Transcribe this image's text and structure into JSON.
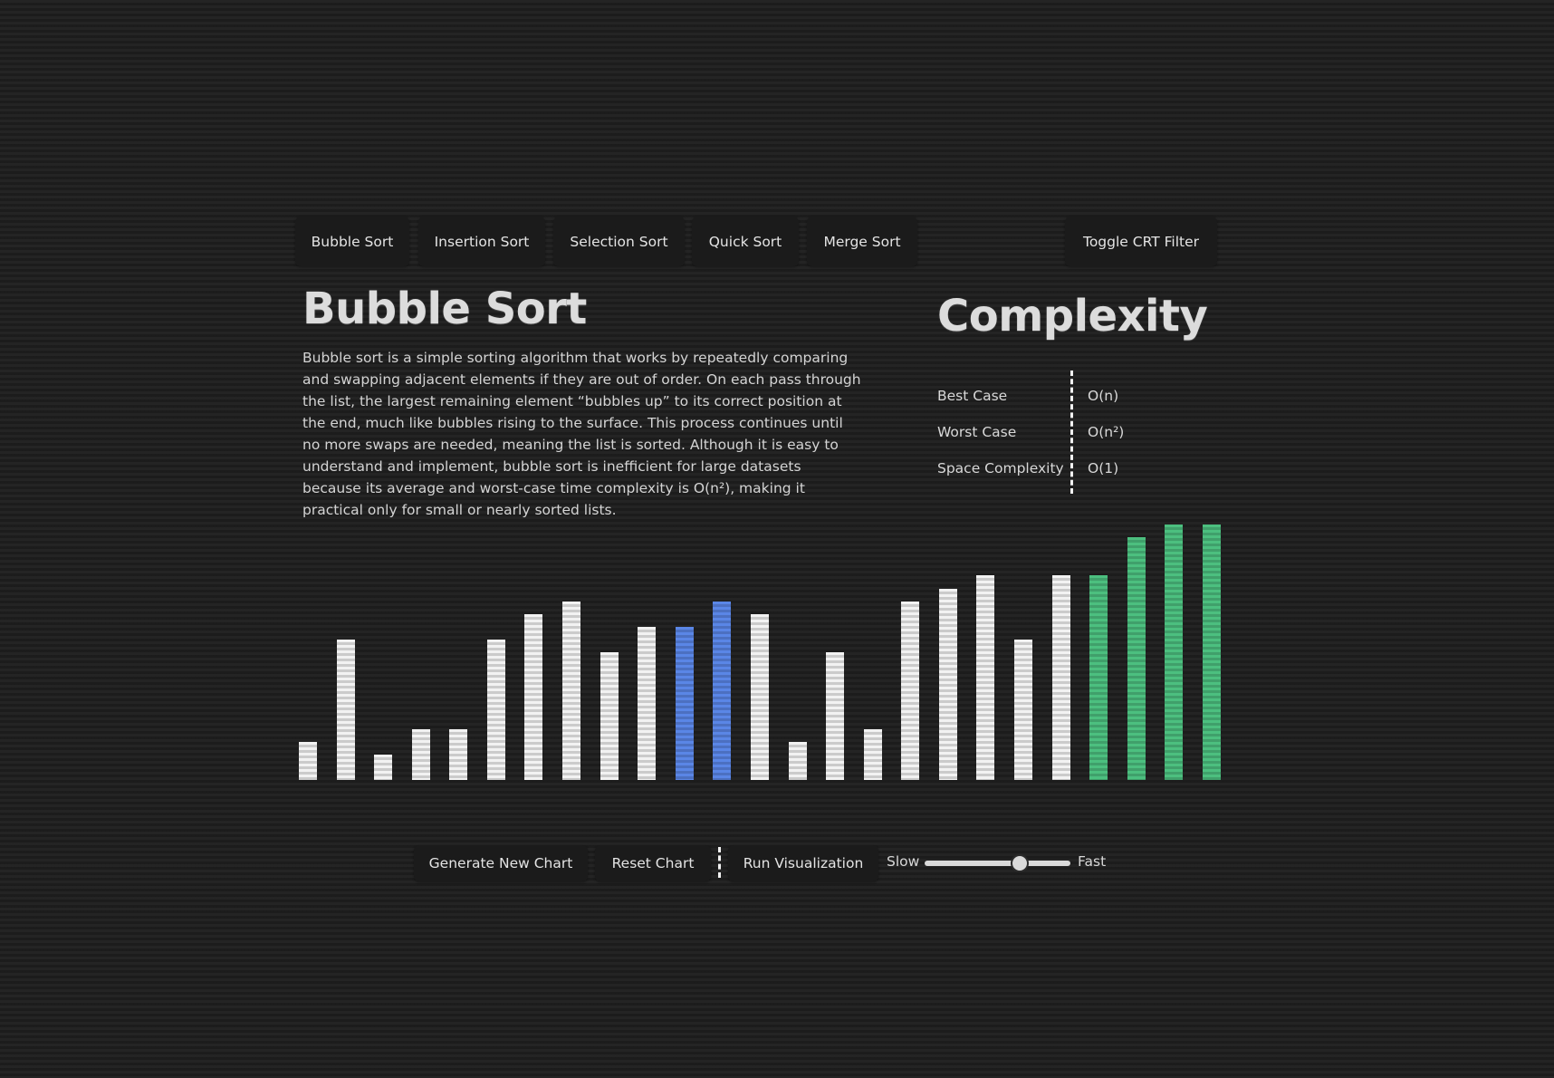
{
  "tabs": [
    {
      "label": "Bubble Sort"
    },
    {
      "label": "Insertion Sort"
    },
    {
      "label": "Selection Sort"
    },
    {
      "label": "Quick Sort"
    },
    {
      "label": "Merge Sort"
    }
  ],
  "crt_toggle_label": "Toggle CRT Filter",
  "algorithm": {
    "title": "Bubble Sort",
    "description": "Bubble sort is a simple sorting algorithm that works by repeatedly comparing and swapping adjacent elements if they are out of order. On each pass through the list, the largest remaining element “bubbles up” to its correct position at the end, much like bubbles rising to the surface. This process continues until no more swaps are needed, meaning the list is sorted. Although it is easy to understand and implement, bubble sort is inefficient for large datasets because its average and worst-case time complexity is O(n²), making it practical only for small or nearly sorted lists."
  },
  "complexity": {
    "title": "Complexity",
    "rows": [
      {
        "label": "Best Case",
        "value": "O(n)"
      },
      {
        "label": "Worst Case",
        "value": "O(n²)"
      },
      {
        "label": "Space Complexity",
        "value": "O(1)"
      }
    ]
  },
  "chart_data": {
    "type": "bar",
    "values": [
      3,
      11,
      2,
      4,
      4,
      11,
      13,
      14,
      10,
      12,
      12,
      14,
      13,
      3,
      10,
      4,
      14,
      15,
      16,
      11,
      16,
      16,
      19,
      20,
      20
    ],
    "states": [
      "default",
      "default",
      "default",
      "default",
      "default",
      "default",
      "default",
      "default",
      "default",
      "default",
      "comparing",
      "comparing",
      "default",
      "default",
      "default",
      "default",
      "default",
      "default",
      "default",
      "default",
      "default",
      "sorted",
      "sorted",
      "sorted",
      "sorted"
    ],
    "ylim": [
      0,
      20
    ],
    "colors": {
      "default": "#f2f2f2",
      "comparing": "#5a86e6",
      "sorted": "#4cbf7f"
    }
  },
  "controls": {
    "generate_label": "Generate New Chart",
    "reset_label": "Reset Chart",
    "run_label": "Run Visualization",
    "slow_label": "Slow",
    "fast_label": "Fast",
    "speed_fraction": 0.6
  }
}
